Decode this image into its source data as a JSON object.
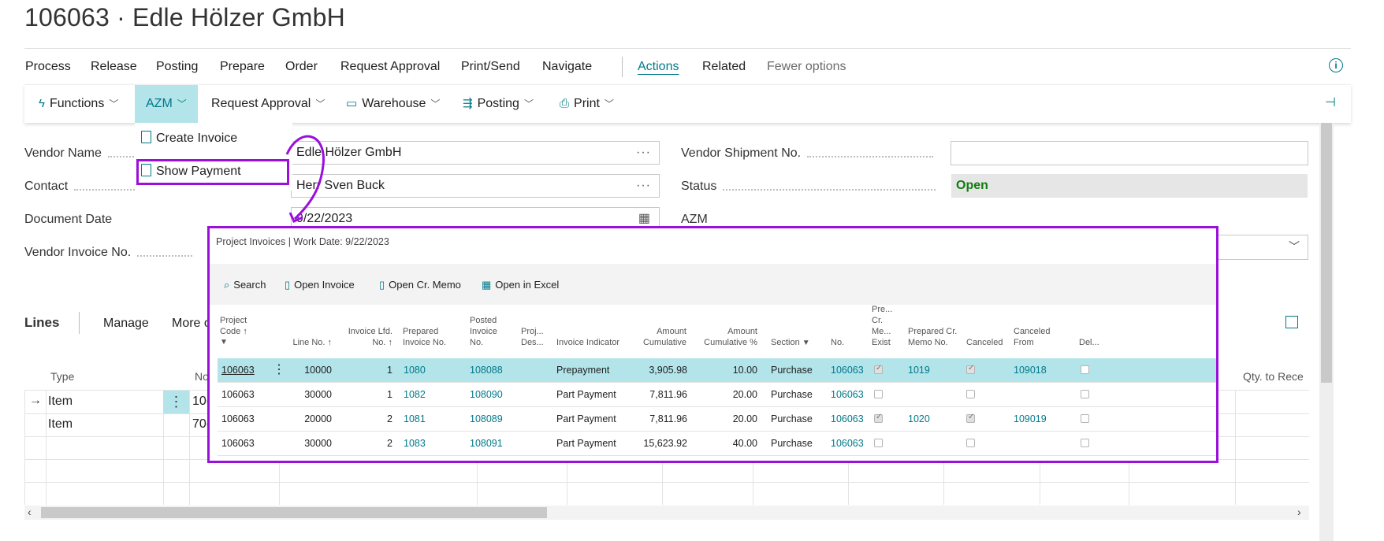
{
  "page": {
    "title": "106063 · Edle Hölzer GmbH"
  },
  "menu": {
    "tabs": [
      "Process",
      "Release",
      "Posting",
      "Prepare",
      "Order",
      "Request Approval",
      "Print/Send",
      "Navigate",
      "Actions",
      "Related",
      "Fewer options"
    ],
    "active": "Actions"
  },
  "action_bar": {
    "functions": "Functions",
    "azm": "AZM",
    "request_approval": "Request Approval",
    "warehouse": "Warehouse",
    "posting": "Posting",
    "print": "Print"
  },
  "azm_menu": {
    "create_invoice": "Create Invoice",
    "show_payment": "Show Payment"
  },
  "form": {
    "vendor_name_label": "Vendor Name",
    "vendor_name": "Edle Hölzer GmbH",
    "contact_label": "Contact",
    "contact": "Herr Sven Buck",
    "document_date_label": "Document Date",
    "document_date": "9/22/2023",
    "vendor_invoice_label": "Vendor Invoice No.",
    "vendor_shipment_label": "Vendor Shipment No.",
    "status_label": "Status",
    "status": "Open",
    "azm_label": "AZM"
  },
  "lines": {
    "title": "Lines",
    "manage": "Manage",
    "more": "More o",
    "col_type": "Type",
    "col_no": "No",
    "col_qty": "Qty. to Rece",
    "rows": [
      {
        "type": "Item",
        "no": "10("
      },
      {
        "type": "Item",
        "no": "70("
      }
    ]
  },
  "popup": {
    "title": "Project Invoices | Work Date: 9/22/2023",
    "buttons": {
      "search": "Search",
      "open_invoice": "Open Invoice",
      "open_cr_memo": "Open Cr. Memo",
      "open_excel": "Open in Excel"
    },
    "headers": {
      "project_code": [
        "Project",
        "Code ↑"
      ],
      "line_no": "Line No. ↑",
      "invoice_lfd": [
        "Invoice Lfd.",
        "No. ↑"
      ],
      "prepared_invoice": [
        "Prepared",
        "Invoice No."
      ],
      "posted_invoice": [
        "Posted",
        "Invoice",
        "No."
      ],
      "proj_des": [
        "Proj...",
        "Des..."
      ],
      "invoice_indicator": "Invoice Indicator",
      "amount_cum": [
        "Amount",
        "Cumulative"
      ],
      "amount_cum_pct": [
        "Amount",
        "Cumulative %"
      ],
      "section": "Section",
      "no": "No.",
      "pre_cr": [
        "Pre...",
        "Cr.",
        "Me...",
        "Exist"
      ],
      "prepared_cr": [
        "Prepared Cr.",
        "Memo No."
      ],
      "canceled": "Canceled",
      "canceled_from": [
        "Canceled",
        "From"
      ],
      "del": "Del..."
    },
    "rows": [
      {
        "project_code": "106063",
        "line_no": "10000",
        "lfd": "1",
        "prepared": "1080",
        "posted": "108088",
        "indicator": "Prepayment",
        "amount": "3,905.98",
        "pct": "10.00",
        "section": "Purchase",
        "no": "106063",
        "cr_exist": true,
        "cr_memo": "1019",
        "canceled": true,
        "canceled_from": "109018",
        "del": false
      },
      {
        "project_code": "106063",
        "line_no": "30000",
        "lfd": "1",
        "prepared": "1082",
        "posted": "108090",
        "indicator": "Part Payment",
        "amount": "7,811.96",
        "pct": "20.00",
        "section": "Purchase",
        "no": "106063",
        "cr_exist": false,
        "cr_memo": "",
        "canceled": false,
        "canceled_from": "",
        "del": false
      },
      {
        "project_code": "106063",
        "line_no": "20000",
        "lfd": "2",
        "prepared": "1081",
        "posted": "108089",
        "indicator": "Part Payment",
        "amount": "7,811.96",
        "pct": "20.00",
        "section": "Purchase",
        "no": "106063",
        "cr_exist": true,
        "cr_memo": "1020",
        "canceled": true,
        "canceled_from": "109019",
        "del": false
      },
      {
        "project_code": "106063",
        "line_no": "30000",
        "lfd": "2",
        "prepared": "1083",
        "posted": "108091",
        "indicator": "Part Payment",
        "amount": "15,623.92",
        "pct": "40.00",
        "section": "Purchase",
        "no": "106063",
        "cr_exist": false,
        "cr_memo": "",
        "canceled": false,
        "canceled_from": "",
        "del": false
      }
    ]
  },
  "colors": {
    "accent": "#00798a",
    "highlight": "#9b0fdb",
    "selected_row": "#b2e4ea",
    "status_open": "#107c10"
  }
}
